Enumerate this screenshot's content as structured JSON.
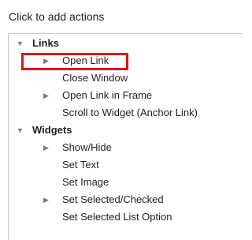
{
  "header": {
    "title": "Click to add actions"
  },
  "tree": {
    "groups": [
      {
        "label": "Links",
        "expanded": true,
        "items": [
          {
            "label": "Open Link",
            "has_children": true,
            "selected": true
          },
          {
            "label": "Close Window",
            "has_children": false,
            "selected": false
          },
          {
            "label": "Open Link in Frame",
            "has_children": true,
            "selected": false
          },
          {
            "label": "Scroll to Widget (Anchor Link)",
            "has_children": false,
            "selected": false
          }
        ]
      },
      {
        "label": "Widgets",
        "expanded": true,
        "items": [
          {
            "label": "Show/Hide",
            "has_children": true,
            "selected": false
          },
          {
            "label": "Set Text",
            "has_children": false,
            "selected": false
          },
          {
            "label": "Set Image",
            "has_children": false,
            "selected": false
          },
          {
            "label": "Set Selected/Checked",
            "has_children": true,
            "selected": false
          },
          {
            "label": "Set Selected List Option",
            "has_children": false,
            "selected": false
          }
        ]
      }
    ]
  },
  "colors": {
    "highlight": "#e0121a",
    "border": "#c9c9c9"
  }
}
